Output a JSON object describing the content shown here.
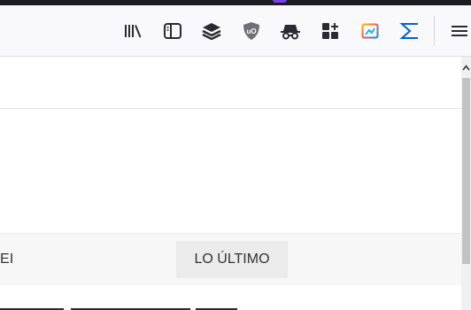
{
  "toolbar": {
    "buttons": [
      {
        "name": "library-icon"
      },
      {
        "name": "sidebar-icon"
      },
      {
        "name": "layers-icon"
      },
      {
        "name": "ublock-origin-icon",
        "badge_text": "uO"
      },
      {
        "name": "incognito-icon"
      },
      {
        "name": "add-apps-icon"
      },
      {
        "name": "screenshot-icon"
      },
      {
        "name": "sum-icon"
      },
      {
        "name": "menu-icon"
      }
    ]
  },
  "page": {
    "nav_left_label": "EI",
    "nav_tab_label": "LO ÚLTIMO"
  },
  "colors": {
    "toolbar_bg": "#f9f9fb",
    "accent": "#7542e5",
    "nav_tab_bg": "#ebebeb"
  }
}
